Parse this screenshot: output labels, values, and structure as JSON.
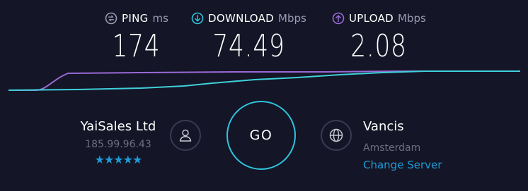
{
  "metrics": {
    "ping": {
      "name": "PING",
      "unit": "ms",
      "value": "174",
      "icon": "ping-icon",
      "color": "#9b9bb0"
    },
    "download": {
      "name": "DOWNLOAD",
      "unit": "Mbps",
      "value": "74.49",
      "icon": "download-arrow-icon",
      "color": "#2ec4de"
    },
    "upload": {
      "name": "UPLOAD",
      "unit": "Mbps",
      "value": "2.08",
      "icon": "upload-arrow-icon",
      "color": "#9a6ad6"
    }
  },
  "graph": {
    "download_color": "#3fd0da",
    "upload_color": "#9a6ad6"
  },
  "isp": {
    "name": "YaiSales Ltd",
    "ip": "185.99.96.43",
    "rating": "★★★★★",
    "icon": "user-icon"
  },
  "go": {
    "label": "GO",
    "color": "#2ec4de"
  },
  "server": {
    "name": "Vancis",
    "location": "Amsterdam",
    "change_label": "Change Server",
    "icon": "globe-icon"
  }
}
